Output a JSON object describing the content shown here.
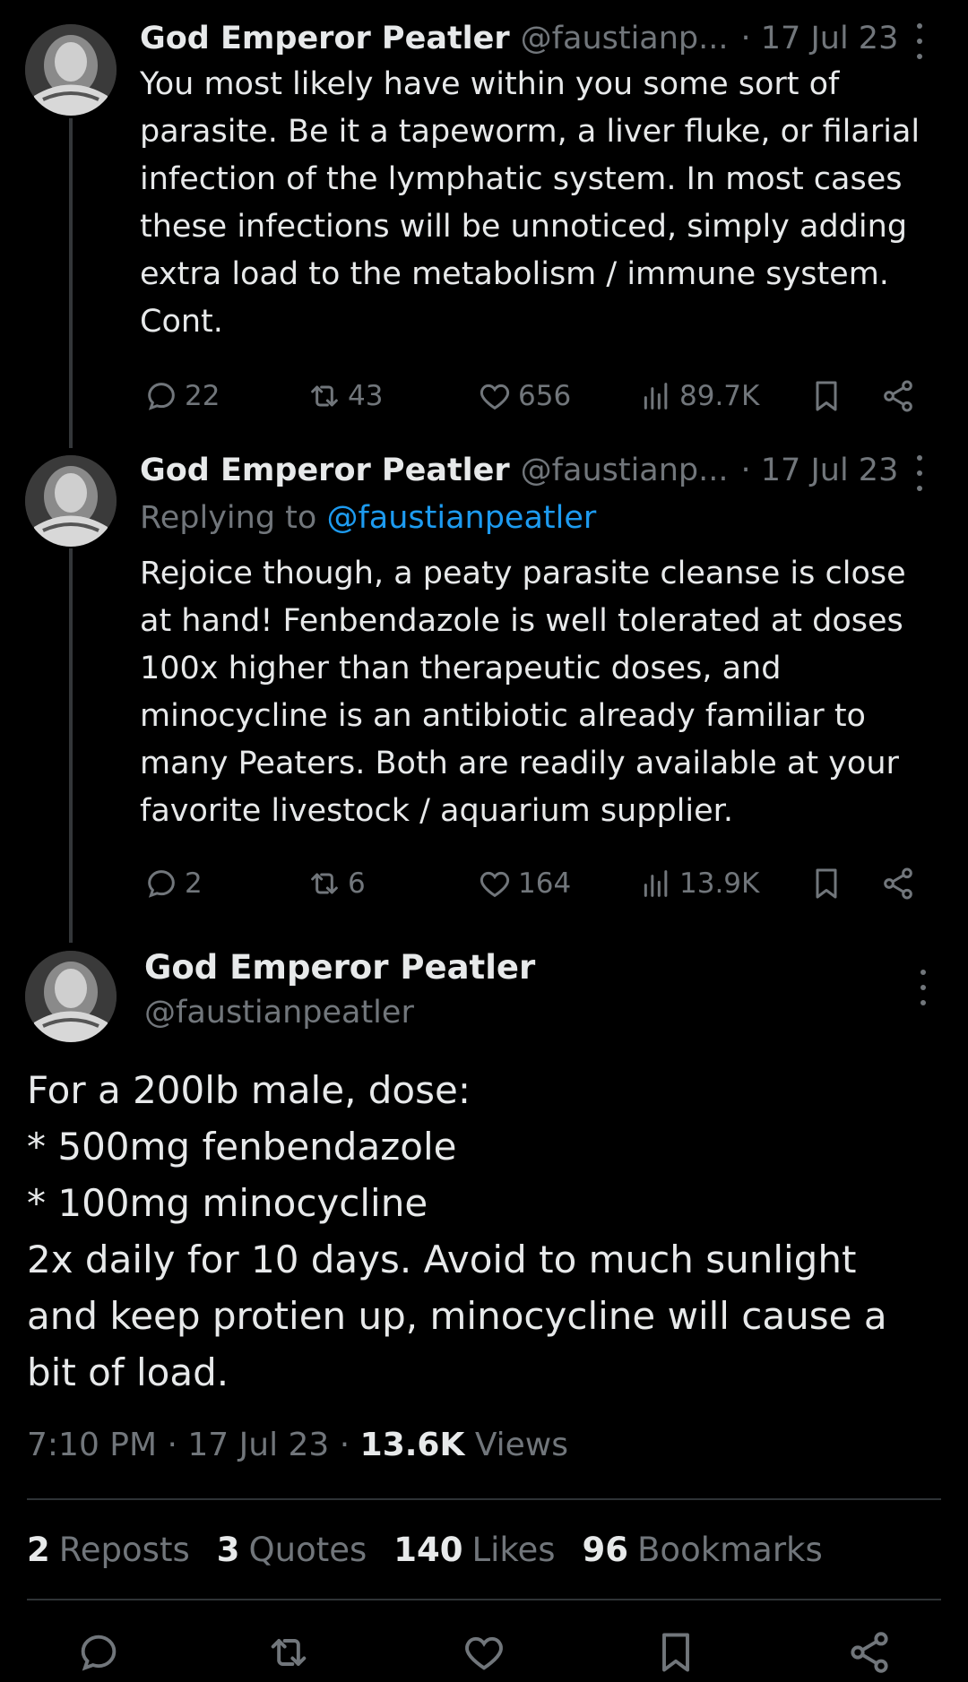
{
  "thread": [
    {
      "name": "God Emperor Peatler",
      "handle": "@faustianp...",
      "date": "· 17 Jul 23",
      "text": "You most likely have within you some sort of\nparasite. Be it a tapeworm, a liver fluke, or filarial\ninfection of the lymphatic system. In most cases\nthese infections will be unnoticed, simply adding\nextra load to the metabolism / immune system.\nCont.",
      "replies": "22",
      "reposts": "43",
      "likes": "656",
      "views": "89.7K"
    },
    {
      "name": "God Emperor Peatler",
      "handle": "@faustianp...",
      "date": "· 17 Jul 23",
      "replying_prefix": "Replying to ",
      "replying_to": "@faustianpeatler",
      "text": "Rejoice though, a peaty parasite cleanse is close\nat hand! Fenbendazole is well tolerated at doses\n100x higher than therapeutic doses, and\nminocycline is an antibiotic already familiar to\nmany Peaters. Both are readily available at your\nfavorite livestock / aquarium supplier.",
      "replies": "2",
      "reposts": "6",
      "likes": "164",
      "views": "13.9K"
    }
  ],
  "main": {
    "name": "God Emperor Peatler",
    "handle": "@faustianpeatler",
    "text": "For a 200lb male, dose:\n* 500mg fenbendazole\n* 100mg minocycline\n2x daily for 10 days. Avoid to much sunlight\nand keep protien up, minocycline will cause a\nbit of load.",
    "time": "7:10 PM · 17 Jul 23 · ",
    "views_count": "13.6K",
    "views_label": " Views",
    "stats": {
      "reposts_count": "2",
      "reposts_label": "Reposts",
      "quotes_count": "3",
      "quotes_label": "Quotes",
      "likes_count": "140",
      "likes_label": "Likes",
      "bookmarks_count": "96",
      "bookmarks_label": "Bookmarks"
    }
  },
  "icons": {
    "reply": "reply-icon",
    "repost": "repost-icon",
    "like": "heart-icon",
    "views": "views-icon",
    "bookmark": "bookmark-icon",
    "share": "share-icon",
    "more": "more-icon"
  },
  "colors": {
    "background": "#000000",
    "text": "#e7e9ea",
    "muted": "#71767b",
    "link": "#1d9bf0"
  }
}
